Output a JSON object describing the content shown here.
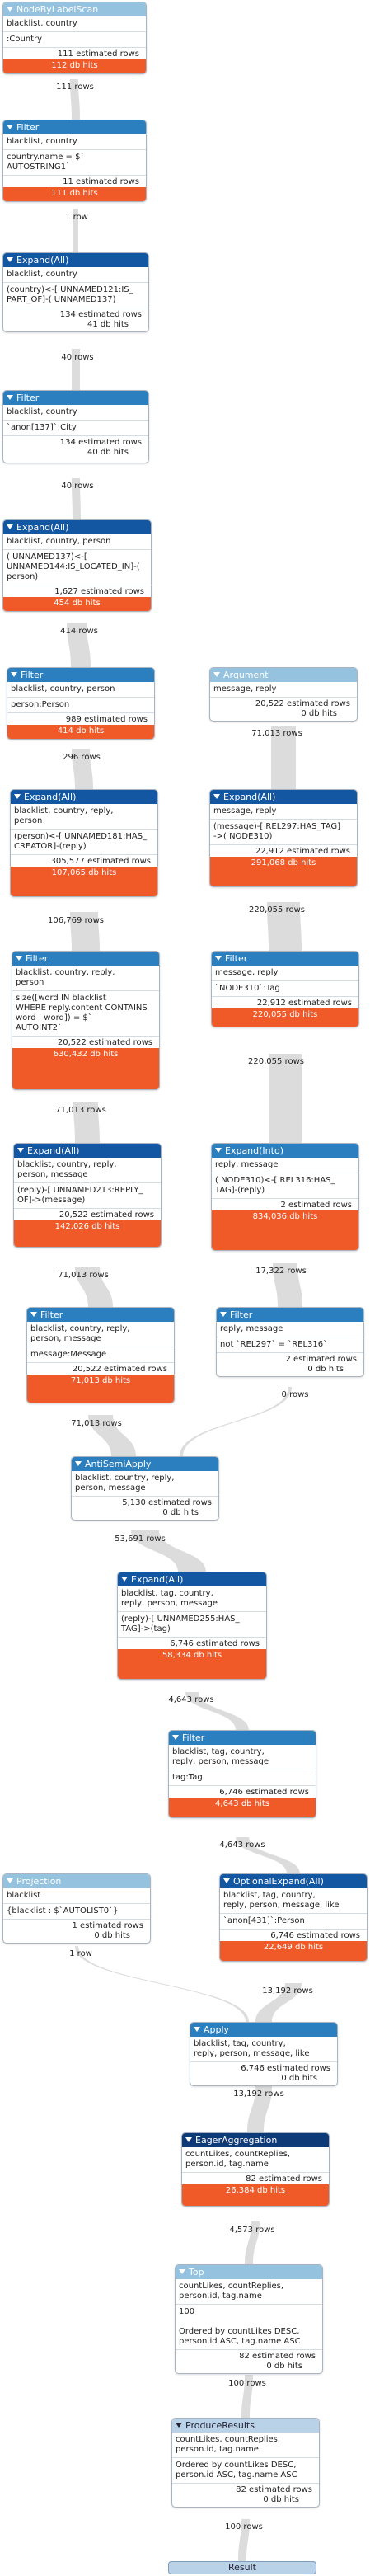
{
  "colors": {
    "flow": "#dcdcdc",
    "head_light": "#94c2df",
    "head_mid": "#2c7fbe",
    "head_dark": "#1356a2",
    "head_darkest": "#0f3a78",
    "head_pale": "#bad2e8",
    "db_hits_bar": "#f05a28"
  },
  "operators": [
    {
      "name": "NodeByLabelScan",
      "ids": "blacklist, country",
      "detail": ":Country",
      "est": "111 estimated rows",
      "hits": "112 db hits",
      "hits_style": "bar"
    },
    {
      "name": "Filter",
      "ids": "blacklist, country",
      "detail": "country.name = $`\nAUTOSTRING1`",
      "est": "11 estimated rows",
      "hits": "111 db hits",
      "hits_style": "bar"
    },
    {
      "name": "Expand(All)",
      "ids": "blacklist, country",
      "detail": "(country)<-[ UNNAMED121:IS_\nPART_OF]-( UNNAMED137)",
      "est": "134 estimated rows",
      "hits": "41 db hits",
      "hits_style": "plain"
    },
    {
      "name": "Filter",
      "ids": "blacklist, country",
      "detail": "`anon[137]`:City",
      "est": "134 estimated rows",
      "hits": "40 db hits",
      "hits_style": "plain"
    },
    {
      "name": "Expand(All)",
      "ids": "blacklist, country, person",
      "detail": "( UNNAMED137)<-[\nUNNAMED144:IS_LOCATED_IN]-(\nperson)",
      "est": "1,627 estimated rows",
      "hits": "454 db hits",
      "hits_style": "bar"
    },
    {
      "name": "Filter",
      "ids": "blacklist, country, person",
      "detail": "person:Person",
      "est": "989 estimated rows",
      "hits": "414 db hits",
      "hits_style": "bar"
    },
    {
      "name": "Argument",
      "ids": "message, reply",
      "detail": "",
      "est": "20,522 estimated rows",
      "hits": "0 db hits",
      "hits_style": "plain"
    },
    {
      "name": "Expand(All)",
      "ids": "blacklist, country, reply,\nperson",
      "detail": "(person)<-[ UNNAMED181:HAS_\nCREATOR]-(reply)",
      "est": "305,577 estimated rows",
      "hits": "107,065 db hits",
      "hits_style": "bar"
    },
    {
      "name": "Expand(All)",
      "ids": "message, reply",
      "detail": "(message)-[ REL297:HAS_TAG]\n->( NODE310)",
      "est": "22,912 estimated rows",
      "hits": "291,068 db hits",
      "hits_style": "bar"
    },
    {
      "name": "Filter",
      "ids": "blacklist, country, reply,\nperson",
      "detail": "size([word IN blacklist\nWHERE reply.content CONTAINS\nword | word]) = $`\nAUTOINT2`",
      "est": "20,522 estimated rows",
      "hits": "630,432 db hits",
      "hits_style": "bar"
    },
    {
      "name": "Filter",
      "ids": "message, reply",
      "detail": "`NODE310`:Tag",
      "est": "22,912 estimated rows",
      "hits": "220,055 db hits",
      "hits_style": "bar"
    },
    {
      "name": "Expand(All)",
      "ids": "blacklist, country, reply,\nperson, message",
      "detail": "(reply)-[ UNNAMED213:REPLY_\nOF]->(message)",
      "est": "20,522 estimated rows",
      "hits": "142,026 db hits",
      "hits_style": "bar"
    },
    {
      "name": "Expand(Into)",
      "ids": "reply, message",
      "detail": "( NODE310)<-[ REL316:HAS_\nTAG]-(reply)",
      "est": "2 estimated rows",
      "hits": "834,036 db hits",
      "hits_style": "bar"
    },
    {
      "name": "Filter",
      "ids": "blacklist, country, reply,\nperson, message",
      "detail": "message:Message",
      "est": "20,522 estimated rows",
      "hits": "71,013 db hits",
      "hits_style": "bar"
    },
    {
      "name": "Filter",
      "ids": "reply, message",
      "detail": "not `REL297` = `REL316`",
      "est": "2 estimated rows",
      "hits": "0 db hits",
      "hits_style": "plain"
    },
    {
      "name": "AntiSemiApply",
      "ids": "blacklist, country, reply,\nperson, message",
      "detail": "",
      "est": "5,130 estimated rows",
      "hits": "0 db hits",
      "hits_style": "plain"
    },
    {
      "name": "Expand(All)",
      "ids": "blacklist, tag, country,\nreply, person, message",
      "detail": "(reply)-[ UNNAMED255:HAS_\nTAG]->(tag)",
      "est": "6,746 estimated rows",
      "hits": "58,334 db hits",
      "hits_style": "bar"
    },
    {
      "name": "Filter",
      "ids": "blacklist, tag, country,\nreply, person, message",
      "detail": "tag:Tag",
      "est": "6,746 estimated rows",
      "hits": "4,643 db hits",
      "hits_style": "bar"
    },
    {
      "name": "Projection",
      "ids": "blacklist",
      "detail": "{blacklist : $`AUTOLIST0`}",
      "est": "1 estimated rows",
      "hits": "0 db hits",
      "hits_style": "plain"
    },
    {
      "name": "OptionalExpand(All)",
      "ids": "blacklist, tag, country,\nreply, person, message, like",
      "detail": "`anon[431]`:Person",
      "est": "6,746 estimated rows",
      "hits": "22,649 db hits",
      "hits_style": "bar"
    },
    {
      "name": "Apply",
      "ids": "blacklist, tag, country,\nreply, person, message, like",
      "detail": "",
      "est": "6,746 estimated rows",
      "hits": "0 db hits",
      "hits_style": "plain"
    },
    {
      "name": "EagerAggregation",
      "ids": "countLikes, countReplies,\nperson.id, tag.name",
      "detail": "",
      "est": "82 estimated rows",
      "hits": "26,384 db hits",
      "hits_style": "bar"
    },
    {
      "name": "Top",
      "ids": "countLikes, countReplies,\nperson.id, tag.name",
      "detail": "100\n\nOrdered by countLikes DESC,\nperson.id ASC, tag.name ASC",
      "est": "82 estimated rows",
      "hits": "0 db hits",
      "hits_style": "plain"
    },
    {
      "name": "ProduceResults",
      "ids": "countLikes, countReplies,\nperson.id, tag.name",
      "detail": "Ordered by countLikes DESC,\nperson.id ASC, tag.name ASC",
      "est": "82 estimated rows",
      "hits": "0 db hits",
      "hits_style": "plain"
    }
  ],
  "row_counts": [
    "111 rows",
    "1 row",
    "40 rows",
    "40 rows",
    "414 rows",
    "296 rows",
    "71,013 rows",
    "106,769 rows",
    "220,055 rows",
    "71,013 rows",
    "220,055 rows",
    "71,013 rows",
    "17,322 rows",
    "71,013 rows",
    "0 rows",
    "53,691 rows",
    "4,643 rows",
    "4,643 rows",
    "1 row",
    "13,192 rows",
    "13,192 rows",
    "4,573 rows",
    "100 rows",
    "100 rows"
  ],
  "result_label": "Result"
}
